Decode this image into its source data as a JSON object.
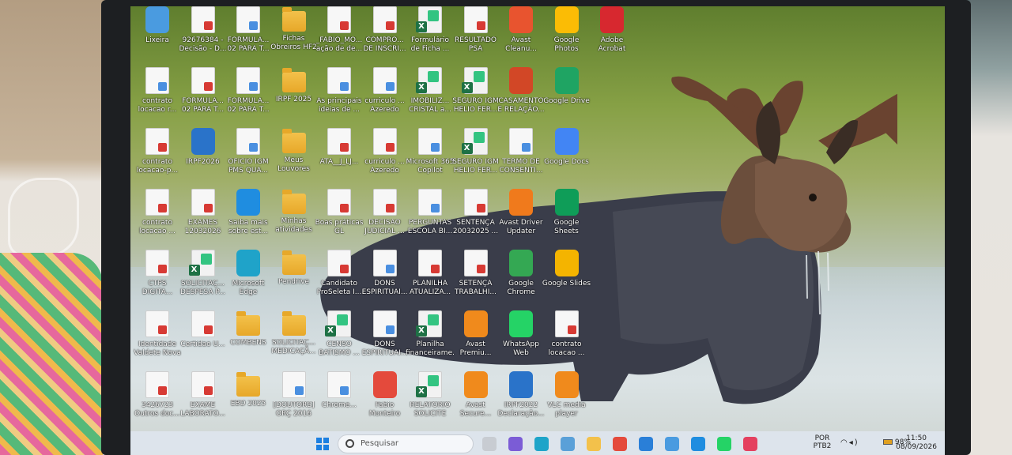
{
  "desktop": {
    "columns": [
      [
        {
          "label": "Lixeira",
          "type": "app",
          "color": "#4a9be0"
        },
        {
          "label": "contrato locacao r...",
          "type": "docw"
        },
        {
          "label": "contrato locacao-p...",
          "type": "doc"
        },
        {
          "label": "contrato locacao ...",
          "type": "doc"
        },
        {
          "label": "CTPS DIGITA...",
          "type": "doc"
        },
        {
          "label": "Identidade Valdete Nova",
          "type": "doc"
        },
        {
          "label": "3426723 Outros doc...",
          "type": "doc"
        }
      ],
      [
        {
          "label": "92676384 - Decisão - D...",
          "type": "doc"
        },
        {
          "label": "FORMULÁ... 02 PARA T...",
          "type": "doc"
        },
        {
          "label": "IRPF2026",
          "type": "app",
          "color": "#2a73c9"
        },
        {
          "label": "EXAMES 12032026",
          "type": "doc"
        },
        {
          "label": "SOLICITAÇ... DESPESA P...",
          "type": "excel"
        },
        {
          "label": "Certidao U...",
          "type": "doc"
        },
        {
          "label": "EXAME LABORATO...",
          "type": "doc"
        }
      ],
      [
        {
          "label": "FORMULÁ... 02 PARA T...",
          "type": "docw"
        },
        {
          "label": "FORMULÁ... 02 PARA T...",
          "type": "docw"
        },
        {
          "label": "OFICIO IGM PMS QUA...",
          "type": "docw"
        },
        {
          "label": "Saiba mais sobre est...",
          "type": "app",
          "color": "#1f8de0"
        },
        {
          "label": "Microsoft Edge",
          "type": "app",
          "color": "#1fa3c9"
        },
        {
          "label": "COMBENS",
          "type": "folder"
        },
        {
          "label": "EBD 2025",
          "type": "folder"
        }
      ],
      [
        {
          "label": "Fichas Obreiros HF2",
          "type": "folder"
        },
        {
          "label": "IRPF 2025",
          "type": "folder"
        },
        {
          "label": "Meus Louvores",
          "type": "folder"
        },
        {
          "label": "Minhas atividades",
          "type": "folder"
        },
        {
          "label": "Pendrive",
          "type": "folder"
        },
        {
          "label": "SOLICITAÇ... MEDICAÇÃ...",
          "type": "folder"
        },
        {
          "label": "[DOUTORS] ORÇ 2016",
          "type": "docw"
        }
      ],
      [
        {
          "label": "_FABIO_MO... ação de de...",
          "type": "doc"
        },
        {
          "label": "As principais ideias de ...",
          "type": "docw"
        },
        {
          "label": "ATA__J_LJ...",
          "type": "doc"
        },
        {
          "label": "Boas práticas GL",
          "type": "doc"
        },
        {
          "label": "Candidato ProSeleta I...",
          "type": "doc"
        },
        {
          "label": "CENSO BATISMO ...",
          "type": "excel"
        },
        {
          "label": "Chrome...",
          "type": "docw"
        }
      ],
      [
        {
          "label": "COMPRO... DE INSCRI...",
          "type": "doc"
        },
        {
          "label": "curriculo ... Azeredo",
          "type": "docw"
        },
        {
          "label": "curriculo ... Azeredo",
          "type": "doc"
        },
        {
          "label": "DECISAO JUDICIAL ...",
          "type": "doc"
        },
        {
          "label": "DONS ESPIRITUAI...",
          "type": "docw"
        },
        {
          "label": "DONS ESPIRITUAI...",
          "type": "docw"
        },
        {
          "label": "Fabio Monteiro",
          "type": "app",
          "color": "#e44a3c"
        }
      ],
      [
        {
          "label": "Formulário de Ficha ...",
          "type": "excel"
        },
        {
          "label": "IMOBILIZ... CRISTAL a...",
          "type": "excel"
        },
        {
          "label": "Microsoft 365 Copilot",
          "type": "docw"
        },
        {
          "label": "PERGUNTAS ESCOLA BI...",
          "type": "docw"
        },
        {
          "label": "PLANILHA ATUALIZA...",
          "type": "doc"
        },
        {
          "label": "Planilha financeirame...",
          "type": "excel"
        },
        {
          "label": "RELATORIO SOLICITE",
          "type": "excel"
        }
      ],
      [
        {
          "label": "RESULTADO PSA",
          "type": "doc"
        },
        {
          "label": "SEGURO IGM HELIO FER...",
          "type": "excel"
        },
        {
          "label": "SEGURO IGM HELIO FER...",
          "type": "excel"
        },
        {
          "label": "SENTENÇA 20032025 ...",
          "type": "doc"
        },
        {
          "label": "SETENÇA TRABALHI...",
          "type": "doc"
        },
        {
          "label": "Avast Premiu...",
          "type": "app",
          "color": "#f08a1c"
        },
        {
          "label": "Avast Secure...",
          "type": "app",
          "color": "#f08a1c"
        }
      ],
      [
        {
          "label": "Avast Cleanu...",
          "type": "app",
          "color": "#e8542f"
        },
        {
          "label": "CASAMENTO E RELAÇÃO...",
          "type": "app",
          "color": "#d24726"
        },
        {
          "label": "TERMO DE CONSENTI...",
          "type": "docw"
        },
        {
          "label": "Avast Driver Updater",
          "type": "app",
          "color": "#f07a1c"
        },
        {
          "label": "Google Chrome",
          "type": "app",
          "color": "#34a853"
        },
        {
          "label": "WhatsApp Web",
          "type": "app",
          "color": "#25d366"
        },
        {
          "label": "IRPF2022 Declaração...",
          "type": "app",
          "color": "#2a73c9"
        }
      ],
      [
        {
          "label": "Google Photos",
          "type": "app",
          "color": "#fbbc05"
        },
        {
          "label": "Google Drive",
          "type": "app",
          "color": "#1fa463"
        },
        {
          "label": "Google Docs",
          "type": "app",
          "color": "#4285f4"
        },
        {
          "label": "Google Sheets",
          "type": "app",
          "color": "#0f9d58"
        },
        {
          "label": "Google Slides",
          "type": "app",
          "color": "#f4b400"
        },
        {
          "label": "contrato locacao ...",
          "type": "doc"
        },
        {
          "label": "VLC media player",
          "type": "app",
          "color": "#f08a1c"
        }
      ],
      [
        {
          "label": "Adobe Acrobat",
          "type": "app",
          "color": "#d7282f"
        }
      ]
    ]
  },
  "taskbar": {
    "search_placeholder": "Pesquisar",
    "language": "POR",
    "layout": "PTB2",
    "battery": "98%",
    "time": "11:50",
    "date": "08/09/2026",
    "pinned_colors": [
      "#c8ccd2",
      "#7b5cd6",
      "#1ea4c9",
      "#5aa0d8",
      "#f3c14b",
      "#e44a3c",
      "#2a7fd8",
      "#4a9be0",
      "#1f8de0",
      "#25d366",
      "#e4405f"
    ]
  }
}
